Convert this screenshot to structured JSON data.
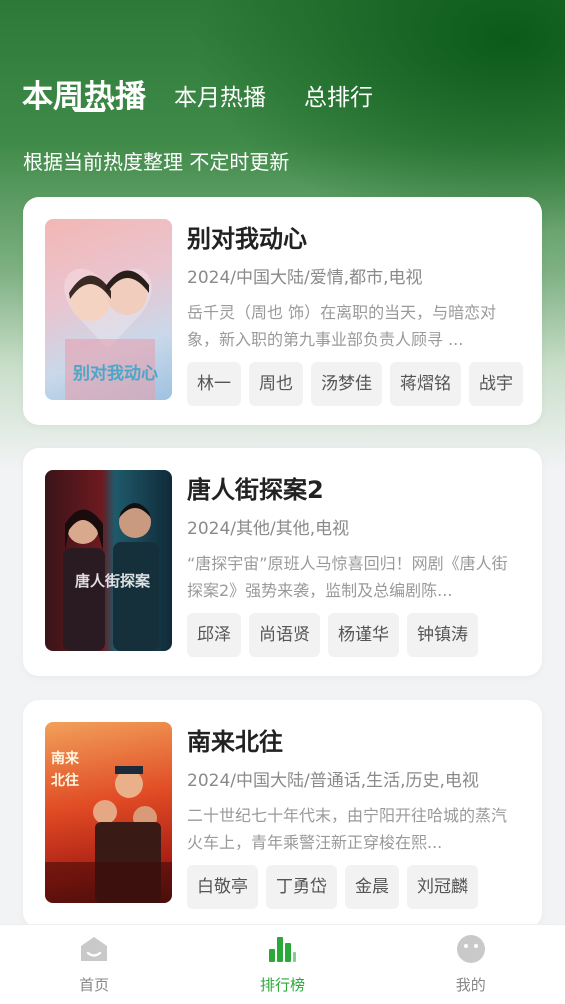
{
  "tabs": [
    {
      "label": "本周热播",
      "active": true
    },
    {
      "label": "本月热播",
      "active": false
    },
    {
      "label": "总排行",
      "active": false
    }
  ],
  "subtitle": "根据当前热度整理 不定时更新",
  "shows": [
    {
      "title": "别对我动心",
      "meta": "2024/中国大陆/爱情,都市,电视",
      "description": "岳千灵（周也 饰）在离职的当天，与暗恋对象，新入职的第九事业部负责人顾寻 ...",
      "actors": [
        "林一",
        "周也",
        "汤梦佳",
        "蒋熠铭",
        "战宇"
      ],
      "poster_text": "别对我动心"
    },
    {
      "title": "唐人街探案2",
      "meta": "2024/其他/其他,电视",
      "description": "“唐探宇宙”原班人马惊喜回归！网剧《唐人街探案2》强势来袭，监制及总编剧陈...",
      "actors": [
        "邱泽",
        "尚语贤",
        "杨谨华",
        "钟镇涛"
      ],
      "poster_text": "唐人街探案"
    },
    {
      "title": "南来北往",
      "meta": "2024/中国大陆/普通话,生活,历史,电视",
      "description": "二十世纪七十年代末，由宁阳开往哈城的蒸汽火车上，青年乘警汪新正穿梭在熙...",
      "actors": [
        "白敬亭",
        "丁勇岱",
        "金晨",
        "刘冠麟"
      ],
      "poster_text": "南来北往"
    }
  ],
  "nav": [
    {
      "label": "首页",
      "icon": "home-icon",
      "active": false
    },
    {
      "label": "排行榜",
      "icon": "ranking-icon",
      "active": true
    },
    {
      "label": "我的",
      "icon": "profile-icon",
      "active": false
    }
  ],
  "colors": {
    "accent": "#2ba83a",
    "header_green": "#0c5a1a"
  }
}
